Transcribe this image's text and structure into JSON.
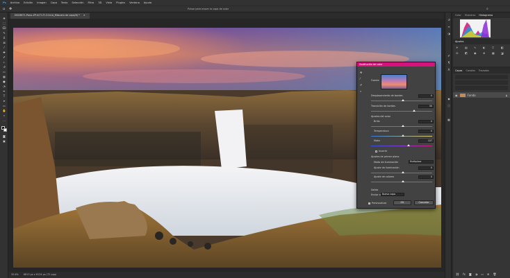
{
  "menu": [
    "Archivo",
    "Edición",
    "Imagen",
    "Capa",
    "Texto",
    "Selección",
    "Filtro",
    "3D",
    "Vista",
    "Plugins",
    "Ventana",
    "Ayuda"
  ],
  "options_bar": {
    "search_hint": "Pulsar para mover la capa de color"
  },
  "document_tab": {
    "title": "DSC6671-Pano-ZP-ki-T1-Ti-3.0d-b_Máscara de capa/8) *"
  },
  "status_bar": {
    "zoom": "32.6%",
    "doc_size": "6813 px x 6124 px (72 ppp)"
  },
  "right_panels": {
    "top_tabs": [
      "Color",
      "Muestras",
      "Histograma"
    ],
    "adjust_tab": "Ajustes",
    "layers_tabs": [
      "Capas",
      "Canales",
      "Trazados"
    ],
    "layer_name": "Fondo"
  },
  "dialog": {
    "title": "Sustitución de color",
    "source_label": "Fuente",
    "sliders": [
      {
        "label": "Desplazamiento de bordes",
        "value": "0"
      },
      {
        "label": "Transición de bordes",
        "value": "50"
      },
      {
        "label": "Brillo",
        "value": "0"
      },
      {
        "label": "Temperatura",
        "value": "0"
      },
      {
        "label": "Matiz",
        "value": "107"
      }
    ],
    "adjust_heading": "Ajustes del color",
    "fill_label": "Invertir",
    "blend_heading": "Ajustes de primer plano",
    "blend_mode_label": "Modo de iluminación",
    "blend_mode_value": "Multiplicar",
    "lighten_label": "Ajuste de iluminación",
    "lighten_value": "0",
    "color_label": "Ajuste de colores",
    "color_value": "0",
    "output_heading": "Salida",
    "output_label": "Enviar a",
    "output_value": "Nueva capa",
    "preview_label": "Previsualizar",
    "ok_label": "OK",
    "cancel_label": "Cancelar"
  },
  "colors": {
    "accent": "#d4147a",
    "ui_dark": "#282828",
    "panel": "#353535"
  }
}
